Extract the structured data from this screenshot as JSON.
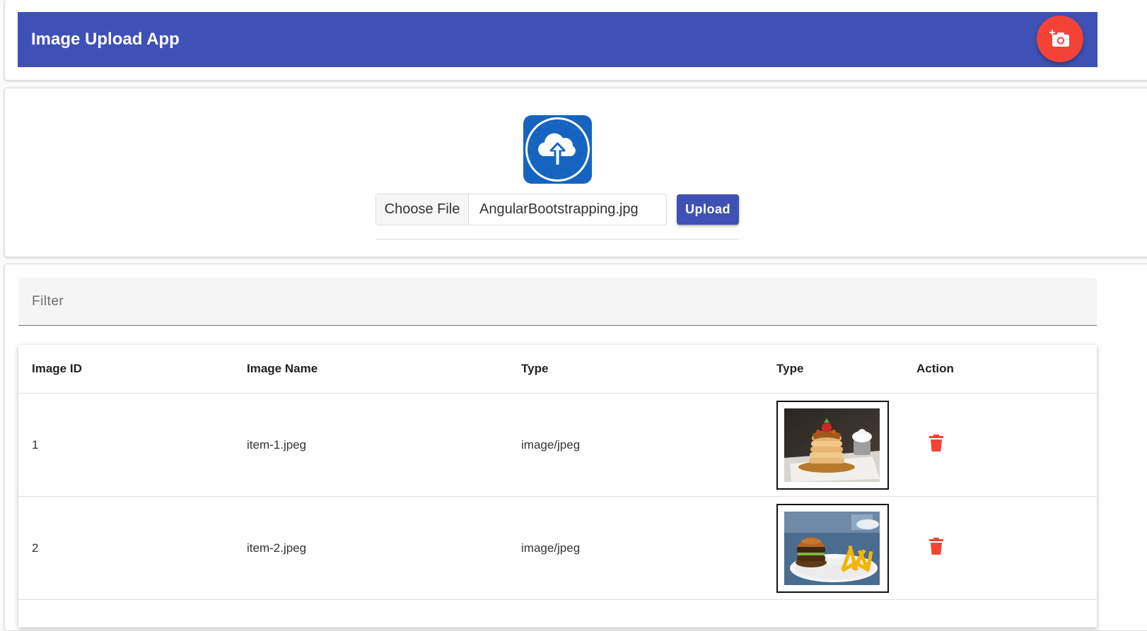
{
  "app": {
    "title": "Image Upload App",
    "fab_icon": "add-photo-icon",
    "colors": {
      "primary": "#3f51b5",
      "accent": "#f44336"
    }
  },
  "upload": {
    "logo_icon": "cloud-upload-icon",
    "choose_label": "Choose File",
    "file_name": "AngularBootstrapping.jpg",
    "upload_label": "Upload"
  },
  "filter": {
    "placeholder": "Filter"
  },
  "table": {
    "headers": [
      "Image ID",
      "Image Name",
      "Type",
      "Type",
      "Action"
    ],
    "rows": [
      {
        "id": "1",
        "name": "item-1.jpeg",
        "type": "image/jpeg",
        "thumb": "pancake-stack-photo",
        "action_icon": "delete-icon"
      },
      {
        "id": "2",
        "name": "item-2.jpeg",
        "type": "image/jpeg",
        "thumb": "burger-and-fries-photo",
        "action_icon": "delete-icon"
      }
    ]
  }
}
